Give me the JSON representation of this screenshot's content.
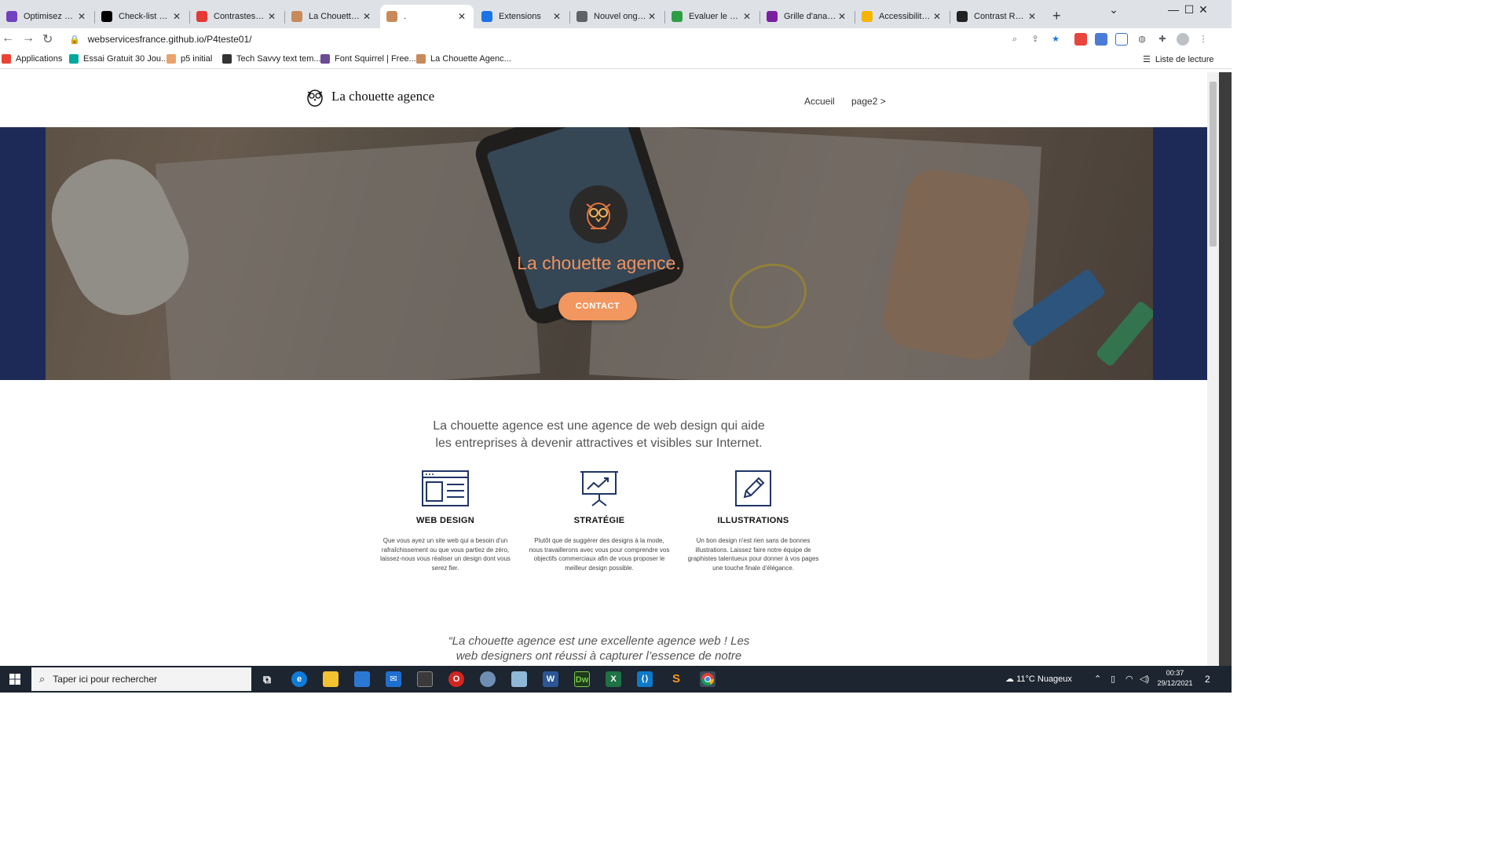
{
  "browser": {
    "tabs": [
      {
        "title": "Optimisez un site",
        "color": "#6f42c1"
      },
      {
        "title": "Check-list pour",
        "color": "#000000"
      },
      {
        "title": "Contrastes de c",
        "color": "#e53935"
      },
      {
        "title": "La Chouette Age",
        "color": "#c98a5a"
      },
      {
        "title": ".",
        "color": "#c98a5a"
      },
      {
        "title": "Extensions",
        "color": "#1a73e8"
      },
      {
        "title": "Nouvel onglet",
        "color": "#5f6368"
      },
      {
        "title": "Evaluer le contr",
        "color": "#2e9e44"
      },
      {
        "title": "Grille d'analyse",
        "color": "#7b1fa2"
      },
      {
        "title": "Accessibilité et",
        "color": "#f4b400"
      },
      {
        "title": "Contrast Ratio",
        "color": "#222222"
      }
    ],
    "active_tab": 4,
    "url": "webservicesfrance.github.io/P4teste01/",
    "bookmarks": [
      {
        "label": "Applications",
        "color": "#ea4335"
      },
      {
        "label": "Essai Gratuit 30 Jou...",
        "color": "#00a99d"
      },
      {
        "label": "p5 initial",
        "color": "#e8a46c"
      },
      {
        "label": "Tech Savvy text tem...",
        "color": "#333333"
      },
      {
        "label": "Font Squirrel | Free...",
        "color": "#6a4c93"
      },
      {
        "label": "La Chouette Agenc...",
        "color": "#c98a5a"
      }
    ],
    "reading_list": "Liste de lecture"
  },
  "site": {
    "logo_text": "La chouette agence",
    "nav": [
      "Accueil",
      "page2 >"
    ],
    "hero_title": "La chouette agence.",
    "contact_label": "CONTACT",
    "intro_line1": "La chouette agence est une agence de web design qui aide",
    "intro_line2": "les entreprises à devenir attractives et visibles sur Internet.",
    "services": [
      {
        "icon": "web-design-icon",
        "title": "WEB DESIGN",
        "desc": "Que vous ayez un site web qui a besoin d'un rafraîchissement ou que vous partiez de zéro, laissez-nous vous réaliser un design dont vous serez fier."
      },
      {
        "icon": "strategy-icon",
        "title": "STRATÉGIE",
        "desc": "Plutôt que de suggérer des designs à la mode, nous travaillerons avec vous pour comprendre vos objectifs commerciaux afin de vous proposer le meilleur design possible."
      },
      {
        "icon": "illustration-icon",
        "title": "ILLUSTRATIONS",
        "desc": "Un bon design n'est rien sans de bonnes illustrations. Laissez faire notre équipe de graphistes talentueux pour donner à vos pages une touche finale d'élégance."
      }
    ],
    "quote_line1": "“La chouette agence est une excellente agence web ! Les",
    "quote_line2": "web designers ont réussi à capturer l’essence de notre",
    "accent_color": "#f2975f"
  },
  "taskbar": {
    "search_placeholder": "Taper ici pour rechercher",
    "weather": "11°C  Nuageux",
    "time": "00:37",
    "date": "29/12/2021",
    "notifications": "2"
  }
}
